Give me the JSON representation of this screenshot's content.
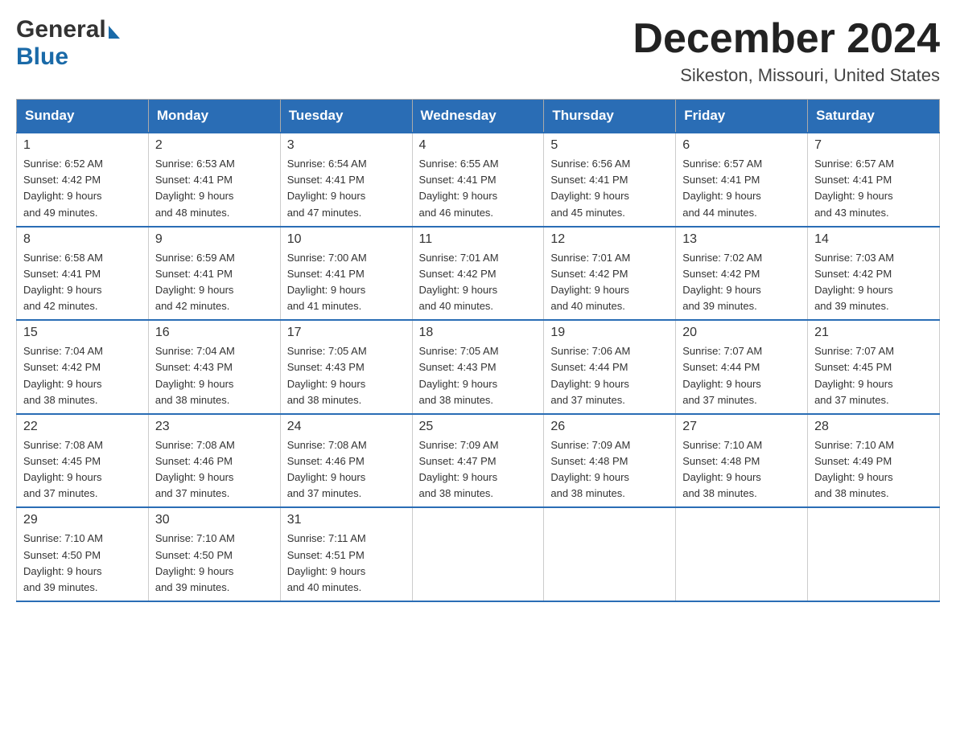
{
  "logo": {
    "general": "General",
    "blue": "Blue"
  },
  "title": "December 2024",
  "location": "Sikeston, Missouri, United States",
  "days_of_week": [
    "Sunday",
    "Monday",
    "Tuesday",
    "Wednesday",
    "Thursday",
    "Friday",
    "Saturday"
  ],
  "weeks": [
    [
      {
        "day": "1",
        "sunrise": "Sunrise: 6:52 AM",
        "sunset": "Sunset: 4:42 PM",
        "daylight": "Daylight: 9 hours",
        "daylight2": "and 49 minutes."
      },
      {
        "day": "2",
        "sunrise": "Sunrise: 6:53 AM",
        "sunset": "Sunset: 4:41 PM",
        "daylight": "Daylight: 9 hours",
        "daylight2": "and 48 minutes."
      },
      {
        "day": "3",
        "sunrise": "Sunrise: 6:54 AM",
        "sunset": "Sunset: 4:41 PM",
        "daylight": "Daylight: 9 hours",
        "daylight2": "and 47 minutes."
      },
      {
        "day": "4",
        "sunrise": "Sunrise: 6:55 AM",
        "sunset": "Sunset: 4:41 PM",
        "daylight": "Daylight: 9 hours",
        "daylight2": "and 46 minutes."
      },
      {
        "day": "5",
        "sunrise": "Sunrise: 6:56 AM",
        "sunset": "Sunset: 4:41 PM",
        "daylight": "Daylight: 9 hours",
        "daylight2": "and 45 minutes."
      },
      {
        "day": "6",
        "sunrise": "Sunrise: 6:57 AM",
        "sunset": "Sunset: 4:41 PM",
        "daylight": "Daylight: 9 hours",
        "daylight2": "and 44 minutes."
      },
      {
        "day": "7",
        "sunrise": "Sunrise: 6:57 AM",
        "sunset": "Sunset: 4:41 PM",
        "daylight": "Daylight: 9 hours",
        "daylight2": "and 43 minutes."
      }
    ],
    [
      {
        "day": "8",
        "sunrise": "Sunrise: 6:58 AM",
        "sunset": "Sunset: 4:41 PM",
        "daylight": "Daylight: 9 hours",
        "daylight2": "and 42 minutes."
      },
      {
        "day": "9",
        "sunrise": "Sunrise: 6:59 AM",
        "sunset": "Sunset: 4:41 PM",
        "daylight": "Daylight: 9 hours",
        "daylight2": "and 42 minutes."
      },
      {
        "day": "10",
        "sunrise": "Sunrise: 7:00 AM",
        "sunset": "Sunset: 4:41 PM",
        "daylight": "Daylight: 9 hours",
        "daylight2": "and 41 minutes."
      },
      {
        "day": "11",
        "sunrise": "Sunrise: 7:01 AM",
        "sunset": "Sunset: 4:42 PM",
        "daylight": "Daylight: 9 hours",
        "daylight2": "and 40 minutes."
      },
      {
        "day": "12",
        "sunrise": "Sunrise: 7:01 AM",
        "sunset": "Sunset: 4:42 PM",
        "daylight": "Daylight: 9 hours",
        "daylight2": "and 40 minutes."
      },
      {
        "day": "13",
        "sunrise": "Sunrise: 7:02 AM",
        "sunset": "Sunset: 4:42 PM",
        "daylight": "Daylight: 9 hours",
        "daylight2": "and 39 minutes."
      },
      {
        "day": "14",
        "sunrise": "Sunrise: 7:03 AM",
        "sunset": "Sunset: 4:42 PM",
        "daylight": "Daylight: 9 hours",
        "daylight2": "and 39 minutes."
      }
    ],
    [
      {
        "day": "15",
        "sunrise": "Sunrise: 7:04 AM",
        "sunset": "Sunset: 4:42 PM",
        "daylight": "Daylight: 9 hours",
        "daylight2": "and 38 minutes."
      },
      {
        "day": "16",
        "sunrise": "Sunrise: 7:04 AM",
        "sunset": "Sunset: 4:43 PM",
        "daylight": "Daylight: 9 hours",
        "daylight2": "and 38 minutes."
      },
      {
        "day": "17",
        "sunrise": "Sunrise: 7:05 AM",
        "sunset": "Sunset: 4:43 PM",
        "daylight": "Daylight: 9 hours",
        "daylight2": "and 38 minutes."
      },
      {
        "day": "18",
        "sunrise": "Sunrise: 7:05 AM",
        "sunset": "Sunset: 4:43 PM",
        "daylight": "Daylight: 9 hours",
        "daylight2": "and 38 minutes."
      },
      {
        "day": "19",
        "sunrise": "Sunrise: 7:06 AM",
        "sunset": "Sunset: 4:44 PM",
        "daylight": "Daylight: 9 hours",
        "daylight2": "and 37 minutes."
      },
      {
        "day": "20",
        "sunrise": "Sunrise: 7:07 AM",
        "sunset": "Sunset: 4:44 PM",
        "daylight": "Daylight: 9 hours",
        "daylight2": "and 37 minutes."
      },
      {
        "day": "21",
        "sunrise": "Sunrise: 7:07 AM",
        "sunset": "Sunset: 4:45 PM",
        "daylight": "Daylight: 9 hours",
        "daylight2": "and 37 minutes."
      }
    ],
    [
      {
        "day": "22",
        "sunrise": "Sunrise: 7:08 AM",
        "sunset": "Sunset: 4:45 PM",
        "daylight": "Daylight: 9 hours",
        "daylight2": "and 37 minutes."
      },
      {
        "day": "23",
        "sunrise": "Sunrise: 7:08 AM",
        "sunset": "Sunset: 4:46 PM",
        "daylight": "Daylight: 9 hours",
        "daylight2": "and 37 minutes."
      },
      {
        "day": "24",
        "sunrise": "Sunrise: 7:08 AM",
        "sunset": "Sunset: 4:46 PM",
        "daylight": "Daylight: 9 hours",
        "daylight2": "and 37 minutes."
      },
      {
        "day": "25",
        "sunrise": "Sunrise: 7:09 AM",
        "sunset": "Sunset: 4:47 PM",
        "daylight": "Daylight: 9 hours",
        "daylight2": "and 38 minutes."
      },
      {
        "day": "26",
        "sunrise": "Sunrise: 7:09 AM",
        "sunset": "Sunset: 4:48 PM",
        "daylight": "Daylight: 9 hours",
        "daylight2": "and 38 minutes."
      },
      {
        "day": "27",
        "sunrise": "Sunrise: 7:10 AM",
        "sunset": "Sunset: 4:48 PM",
        "daylight": "Daylight: 9 hours",
        "daylight2": "and 38 minutes."
      },
      {
        "day": "28",
        "sunrise": "Sunrise: 7:10 AM",
        "sunset": "Sunset: 4:49 PM",
        "daylight": "Daylight: 9 hours",
        "daylight2": "and 38 minutes."
      }
    ],
    [
      {
        "day": "29",
        "sunrise": "Sunrise: 7:10 AM",
        "sunset": "Sunset: 4:50 PM",
        "daylight": "Daylight: 9 hours",
        "daylight2": "and 39 minutes."
      },
      {
        "day": "30",
        "sunrise": "Sunrise: 7:10 AM",
        "sunset": "Sunset: 4:50 PM",
        "daylight": "Daylight: 9 hours",
        "daylight2": "and 39 minutes."
      },
      {
        "day": "31",
        "sunrise": "Sunrise: 7:11 AM",
        "sunset": "Sunset: 4:51 PM",
        "daylight": "Daylight: 9 hours",
        "daylight2": "and 40 minutes."
      },
      null,
      null,
      null,
      null
    ]
  ]
}
